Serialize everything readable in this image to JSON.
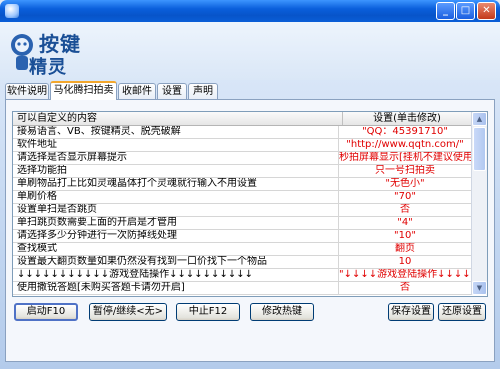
{
  "window": {
    "title": "",
    "controls": {
      "minimize": "_",
      "maximize": "□",
      "close": "✕"
    }
  },
  "logo": {
    "line1": "按键",
    "line2": "精灵"
  },
  "tabs": [
    {
      "label": "软件说明",
      "active": false
    },
    {
      "label": "马化腾扫拍卖",
      "active": true
    },
    {
      "label": "收邮件",
      "active": false
    },
    {
      "label": "设置",
      "active": false
    },
    {
      "label": "声明",
      "active": false
    }
  ],
  "table": {
    "headers": {
      "content": "可以自定义的内容",
      "setting": "设置(单击修改)"
    },
    "rows": [
      {
        "content": "接易语言、VB、按键精灵、脱壳破解",
        "setting": "\"QQ：45391710\""
      },
      {
        "content": "软件地址",
        "setting": "\"http://www.qqtn.com/\""
      },
      {
        "content": "请选择是否显示屏幕提示",
        "setting": "秒拍屏幕显示[挂机不建议使用]"
      },
      {
        "content": "选择功能拍",
        "setting": "只一号扫拍卖"
      },
      {
        "content": "单刷物品打上比如灵魂晶体打个灵魂就行输入不用设置",
        "setting": "\"无色小\""
      },
      {
        "content": "单刷价格",
        "setting": "\"70\""
      },
      {
        "content": "设置单扫是否跳页",
        "setting": "否"
      },
      {
        "content": "单扫跳页数需要上面的开启是才管用",
        "setting": "\"4\""
      },
      {
        "content": "请选择多少分钟进行一次防掉线处理",
        "setting": "\"10\""
      },
      {
        "content": "查找模式",
        "setting": "翻页"
      },
      {
        "content": "设置最大翻页数量如果仍然没有找到一口价找下一个物品",
        "setting": "10"
      },
      {
        "content": "↓↓↓↓↓↓↓↓↓↓↓游戏登陆操作↓↓↓↓↓↓↓↓↓↓",
        "setting": "\"↓↓↓↓游戏登陆操作↓↓↓↓\""
      },
      {
        "content": "使用撒锐答题[未购买答题卡请勿开启]",
        "setting": "否"
      }
    ],
    "selected_row": -1
  },
  "buttons": {
    "start": "启动F10",
    "pause": "暂停/继续<无>",
    "stop": "中止F12",
    "hotkey": "修改热键",
    "save": "保存设置",
    "restore": "还原设置"
  },
  "colors": {
    "titlebar": "#0754c9",
    "setting_text": "#e00000",
    "active_tab_accent": "#f3a72c"
  }
}
